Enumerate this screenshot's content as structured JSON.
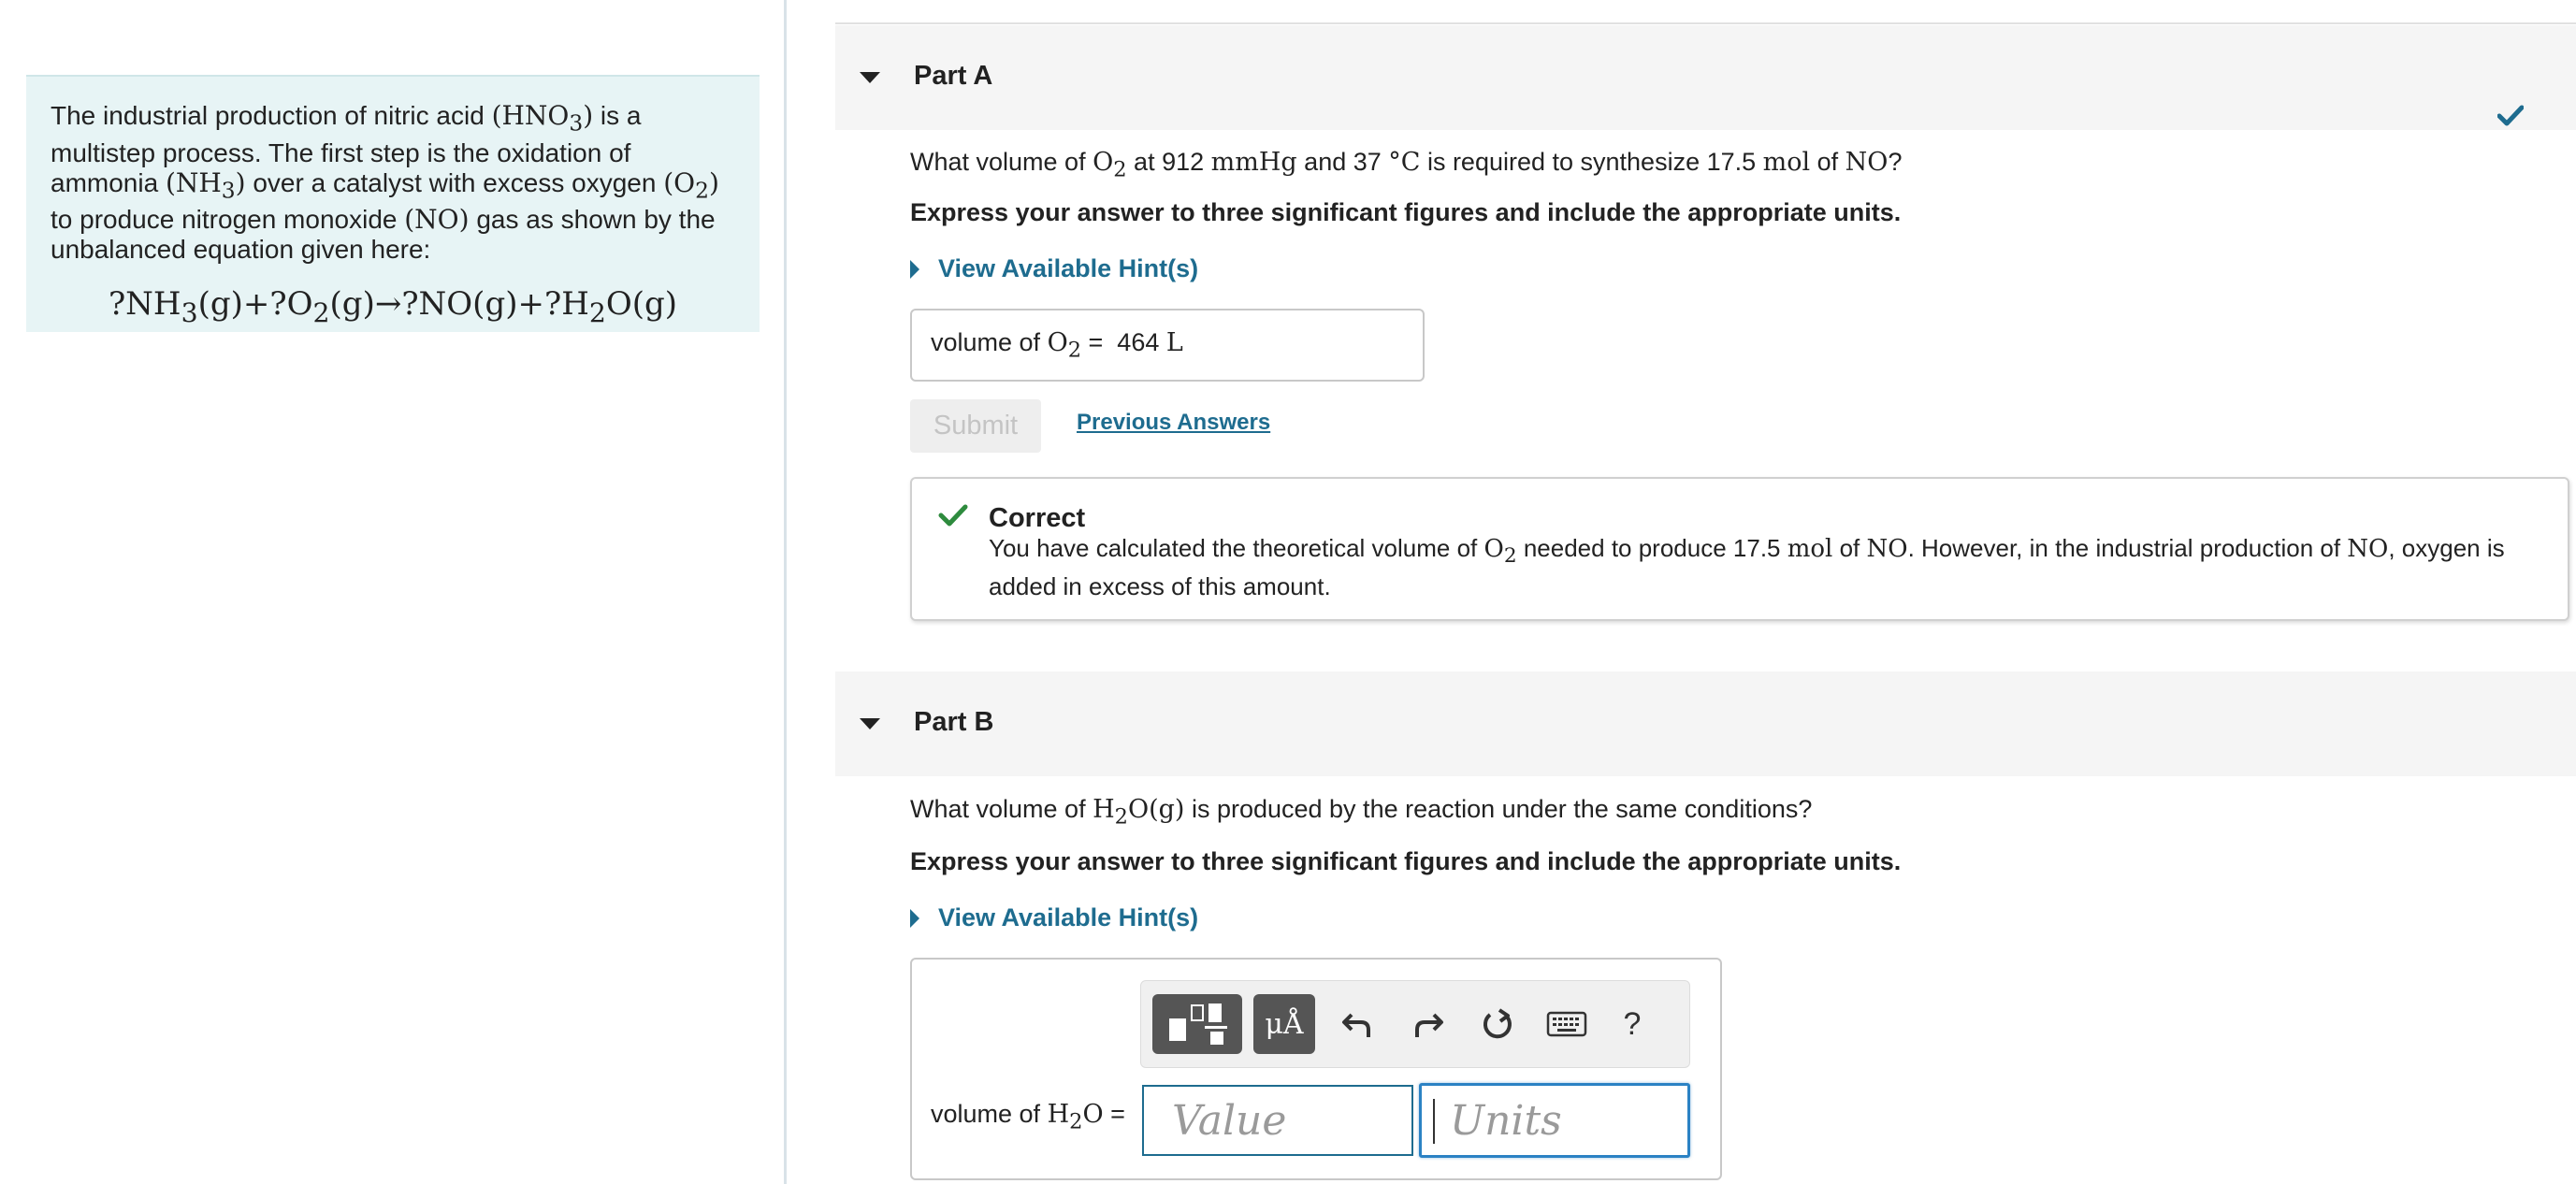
{
  "intro": {
    "text_html": "The industrial production of nitric acid <span class=\"serif\">(HNO<sub>3</sub>)</span> is a multistep process. The first step is the oxidation of ammonia <span class=\"serif\">(NH<sub>3</sub>)</span> over a catalyst with excess oxygen <span class=\"serif\">(O<sub>2</sub>)</span> to produce nitrogen monoxide <span class=\"serif\">(NO)</span> gas as shown by the unbalanced equation given here:",
    "equation_html": "?NH<sub>3</sub>(g)+?O<sub>2</sub>(g)&rarr;?NO(g)+?H<sub>2</sub>O(g)"
  },
  "partA": {
    "title": "Part A",
    "question_html": "What volume of <span class=\"serif\">O<sub>2</sub></span> at 912 <span class=\"serif\">mmHg</span> and 37 <span class=\"serif\">&deg;C</span> is required to synthesize 17.5 <span class=\"serif\">mol</span> of <span class=\"serif\">NO</span>?",
    "instructions": "Express your answer to three significant figures and include the appropriate units.",
    "hint_link": "View Available Hint(s)",
    "answer_label_html": "volume of <span class=\"serif\">O<sub>2</sub></span> = &nbsp;464 <span class=\"serif\">L</span>",
    "submit_label": "Submit",
    "previous_answers_label": "Previous Answers",
    "feedback_title": "Correct",
    "feedback_html": "You have calculated the theoretical volume of <span class=\"serif\">O<sub>2</sub></span> needed to produce 17.5 <span class=\"serif\">mol</span> of <span class=\"serif\">NO</span>. However, in the industrial production of <span class=\"serif\">NO</span>, oxygen is added in excess of this amount."
  },
  "partB": {
    "title": "Part B",
    "question_html": "What volume of <span class=\"serif\">H<sub>2</sub>O(g)</span> is produced by the reaction under the same conditions?",
    "instructions": "Express your answer to three significant figures and include the appropriate units.",
    "hint_link": "View Available Hint(s)",
    "answer_label_html": "volume of <span class=\"serif\">H<sub>2</sub>O</span> =",
    "units_button_label": "μÅ",
    "help_label": "?",
    "value_placeholder": "Value",
    "units_placeholder": "Units"
  },
  "colors": {
    "link": "#1e6c8f",
    "correct_green": "#2e8b3e",
    "intro_bg": "#e7f4f5"
  }
}
